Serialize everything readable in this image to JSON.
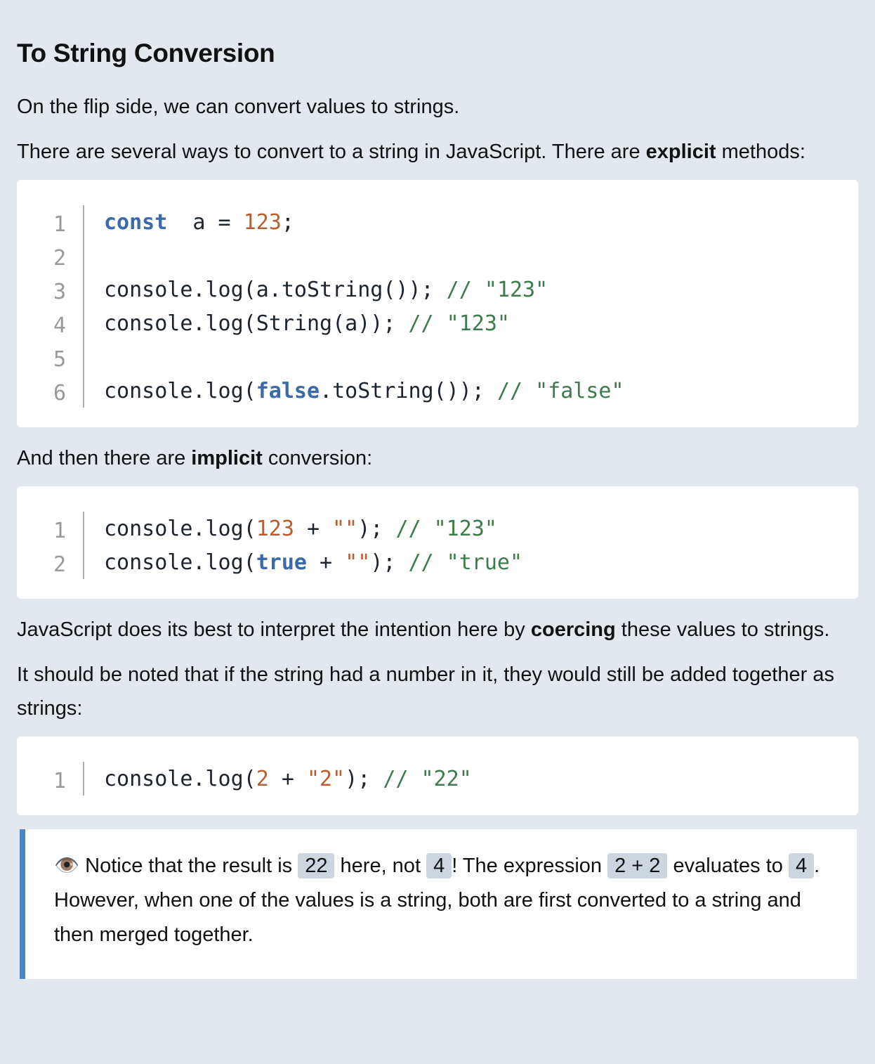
{
  "heading": "To String Conversion",
  "paragraphs": {
    "p1": "On the flip side, we can convert values to strings.",
    "p2_a": "There are several ways to convert to a string in JavaScript. There are ",
    "p2_b": "explicit",
    "p2_c": " methods:",
    "p3_a": "And then there are ",
    "p3_b": "implicit",
    "p3_c": " conversion:",
    "p4_a": "JavaScript does its best to interpret the intention here by ",
    "p4_b": "coercing",
    "p4_c": " these values to strings.",
    "p5": "It should be noted that if the string had a number in it, they would still be added together as strings:"
  },
  "code_blocks": [
    {
      "lines": [
        [
          [
            "kw",
            "const"
          ],
          [
            "",
            "  a = "
          ],
          [
            "num",
            "123"
          ],
          [
            "",
            ";"
          ]
        ],
        [],
        [
          [
            "",
            "console.log(a.toString()); "
          ],
          [
            "com",
            "// \"123\""
          ]
        ],
        [
          [
            "",
            "console.log(String(a)); "
          ],
          [
            "com",
            "// \"123\""
          ]
        ],
        [],
        [
          [
            "",
            "console.log("
          ],
          [
            "kw",
            "false"
          ],
          [
            "",
            ".toString()); "
          ],
          [
            "com",
            "// \"false\""
          ]
        ]
      ]
    },
    {
      "lines": [
        [
          [
            "",
            "console.log("
          ],
          [
            "num",
            "123"
          ],
          [
            "",
            " + "
          ],
          [
            "str",
            "\"\""
          ],
          [
            "",
            "); "
          ],
          [
            "com",
            "// \"123\""
          ]
        ],
        [
          [
            "",
            "console.log("
          ],
          [
            "kw",
            "true"
          ],
          [
            "",
            " + "
          ],
          [
            "str",
            "\"\""
          ],
          [
            "",
            "); "
          ],
          [
            "com",
            "// \"true\""
          ]
        ]
      ]
    },
    {
      "lines": [
        [
          [
            "",
            "console.log("
          ],
          [
            "num",
            "2"
          ],
          [
            "",
            " + "
          ],
          [
            "str",
            "\"2\""
          ],
          [
            "",
            "); "
          ],
          [
            "com",
            "// \"22\""
          ]
        ]
      ]
    }
  ],
  "callout": {
    "icon": "eye-icon",
    "t1": " Notice that the result is ",
    "c1": "22",
    "t2": " here, not ",
    "c2": "4",
    "t3": "! The expression ",
    "c3": "2 + 2",
    "t4": " evaluates to ",
    "c4": "4",
    "t5": ". However, when one of the values is a string, both are first converted to a string and then merged together."
  },
  "colors": {
    "keyword": "#3a6aa8",
    "number": "#b95d2c",
    "comment": "#3e7b4c",
    "callout_border": "#4a86c8"
  }
}
